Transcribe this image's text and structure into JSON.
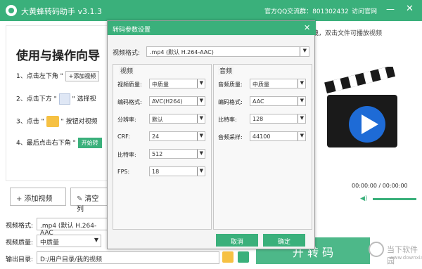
{
  "app": {
    "title": "大黄蜂转码助手 v3.1.3",
    "qq_group": "官方QQ交流群：801302432",
    "official_site": "访问官网",
    "minimize": "—",
    "close": "✕"
  },
  "guide": {
    "heading": "使用与操作向导",
    "step1_prefix": "1、点击左下角 \"",
    "step1_chip": "+添加视频",
    "step2_prefix": "2、点击下方 \"",
    "step2_suffix": "\" 选择视",
    "step3_prefix": "3、点击 \"",
    "step3_suffix": "\" 按钮对视频",
    "step4_prefix": "4、最后点击右下角 \"",
    "step4_chip": "开始转"
  },
  "player": {
    "hint": "拽，双击文件可播放视频",
    "time": "00:00:00 / 00:00:00"
  },
  "bottom": {
    "add_video": "添加视频",
    "clear": "清空列",
    "format_label": "视频格式:",
    "format_value": ".mp4 (默认 H.264-AAC",
    "quality_label": "视频质量:",
    "quality_value": "中质量",
    "output_label": "输出目录:",
    "output_value": "D:/用户目录/我的视频",
    "start": "开 转 码"
  },
  "dialog": {
    "title": "转码参数设置",
    "close": "✕",
    "vformat_label": "视频格式:",
    "vformat_value": ".mp4 (默认 H.264-AAC)",
    "video_group": "视频",
    "audio_group": "音频",
    "video": [
      {
        "label": "视频质量:",
        "value": "中质量"
      },
      {
        "label": "编码格式:",
        "value": "AVC(H264)"
      },
      {
        "label": "分辨率:",
        "value": "默认"
      },
      {
        "label": "CRF:",
        "value": "24"
      },
      {
        "label": "比特率:",
        "value": "512"
      },
      {
        "label": "FPS:",
        "value": "18"
      }
    ],
    "audio": [
      {
        "label": "音频质量:",
        "value": "中质量"
      },
      {
        "label": "编码格式:",
        "value": "AAC"
      },
      {
        "label": "比特率:",
        "value": "128"
      },
      {
        "label": "音频采样:",
        "value": "44100"
      }
    ],
    "cancel": "取消",
    "ok": "确定"
  },
  "watermark": {
    "main": "当下软件园",
    "sub": "www.downxia.com"
  },
  "colors": {
    "accent": "#3ab07b",
    "folder": "#f6c143"
  }
}
